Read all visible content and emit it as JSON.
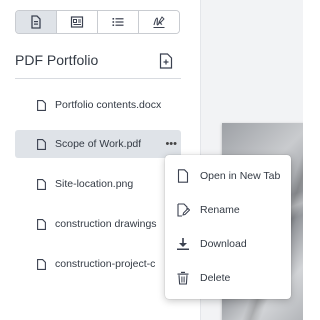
{
  "toolbar": {
    "views": [
      {
        "icon": "file-view-icon",
        "active": true
      },
      {
        "icon": "details-view-icon",
        "active": false
      },
      {
        "icon": "list-view-icon",
        "active": false
      },
      {
        "icon": "signature-icon",
        "active": false
      }
    ]
  },
  "sidebar": {
    "title": "PDF Portfolio",
    "add_icon": "add-file-icon",
    "files": [
      {
        "name": "Portfolio contents.docx",
        "selected": false
      },
      {
        "name": "Scope of Work.pdf",
        "selected": true
      },
      {
        "name": "Site-location.png",
        "selected": false
      },
      {
        "name": "construction drawings",
        "selected": false
      },
      {
        "name": "construction-project-c",
        "selected": false
      }
    ],
    "more_label": "•••"
  },
  "context_menu": {
    "items": [
      {
        "label": "Open in New Tab",
        "icon": "open-document-icon"
      },
      {
        "label": "Rename",
        "icon": "rename-icon"
      },
      {
        "label": "Download",
        "icon": "download-icon"
      },
      {
        "label": "Delete",
        "icon": "trash-icon"
      }
    ]
  },
  "colors": {
    "selected_bg": "#dfe3e8",
    "text": "#333a44",
    "border": "#c9ccd1"
  }
}
